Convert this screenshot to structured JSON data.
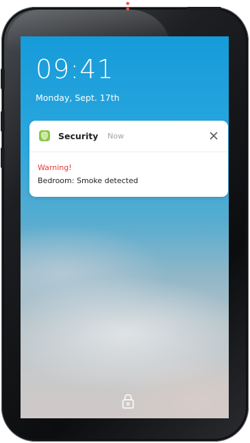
{
  "lockscreen": {
    "time": "09:41",
    "date": "Monday, Sept. 17th"
  },
  "notification": {
    "app_name": "Security",
    "timestamp": "Now",
    "title": "Warning!",
    "message": "Bedroom: Smoke detected",
    "title_color": "#e53935",
    "app_icon_color": "#8cc84b",
    "app_icon": "shield-icon",
    "close_icon": "close-icon"
  },
  "footer": {
    "unlock_icon": "lock-icon"
  }
}
